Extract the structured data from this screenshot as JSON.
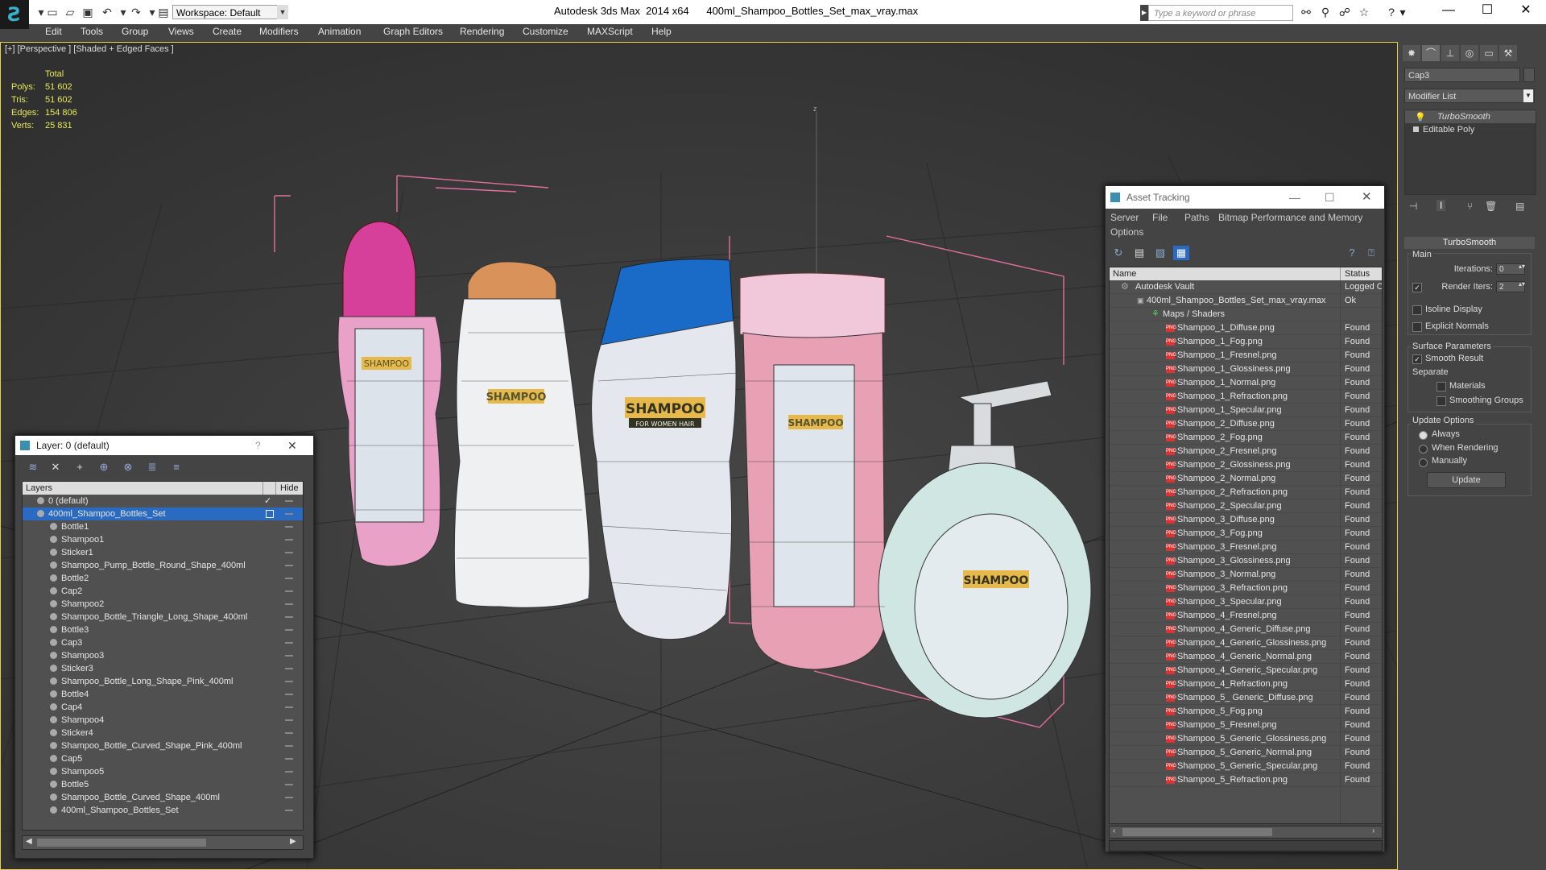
{
  "titlebar": {
    "workspace": "Workspace: Default",
    "app": "Autodesk 3ds Max  2014 x64",
    "file": "400ml_Shampoo_Bottles_Set_max_vray.max",
    "search_placeholder": "Type a keyword or phrase"
  },
  "menu": [
    "Edit",
    "Tools",
    "Group",
    "Views",
    "Create",
    "Modifiers",
    "Animation",
    "Graph Editors",
    "Rendering",
    "Customize",
    "MAXScript",
    "Help"
  ],
  "viewport": {
    "label": "[+] [Perspective ] [Shaded + Edged Faces ]",
    "axis_label": "z",
    "stats": {
      "header": "Total",
      "rows": [
        {
          "k": "Polys:",
          "v": "51 602"
        },
        {
          "k": "Tris:",
          "v": "51 602"
        },
        {
          "k": "Edges:",
          "v": "154 806"
        },
        {
          "k": "Verts:",
          "v": "25 831"
        }
      ]
    },
    "label_text": {
      "large": "SHAMPOO",
      "sub": "FOR WOMEN HAIR"
    }
  },
  "cmd": {
    "object_name": "Cap3",
    "modifier_list": "Modifier List",
    "stack": [
      "TurboSmooth",
      "Editable Poly"
    ],
    "turbosmooth": "TurboSmooth",
    "main": "Main",
    "iterations_label": "Iterations:",
    "iterations": "0",
    "render_iters_label": "Render Iters:",
    "render_iters": "2",
    "isoline": "Isoline Display",
    "explicit": "Explicit Normals",
    "surface": "Surface Parameters",
    "smooth_result": "Smooth Result",
    "separate": "Separate",
    "materials": "Materials",
    "smoothing_groups": "Smoothing Groups",
    "update_options": "Update Options",
    "always": "Always",
    "when_rendering": "When Rendering",
    "manually": "Manually",
    "update_btn": "Update"
  },
  "layer": {
    "title": "Layer: 0 (default)",
    "help": "?",
    "col_layers": "Layers",
    "col_hide": "Hide",
    "rows": [
      {
        "name": "0 (default)",
        "indent": 0,
        "kind": "layer",
        "checked": true
      },
      {
        "name": "400ml_Shampoo_Bottles_Set",
        "indent": 0,
        "kind": "layer",
        "selected": true
      },
      {
        "name": "Bottle1",
        "indent": 1
      },
      {
        "name": "Shampoo1",
        "indent": 1
      },
      {
        "name": "Sticker1",
        "indent": 1
      },
      {
        "name": "Shampoo_Pump_Bottle_Round_Shape_400ml",
        "indent": 1
      },
      {
        "name": "Bottle2",
        "indent": 1
      },
      {
        "name": "Cap2",
        "indent": 1
      },
      {
        "name": "Shampoo2",
        "indent": 1
      },
      {
        "name": "Shampoo_Bottle_Triangle_Long_Shape_400ml",
        "indent": 1
      },
      {
        "name": "Bottle3",
        "indent": 1
      },
      {
        "name": "Cap3",
        "indent": 1
      },
      {
        "name": "Shampoo3",
        "indent": 1
      },
      {
        "name": "Sticker3",
        "indent": 1
      },
      {
        "name": "Shampoo_Bottle_Long_Shape_Pink_400ml",
        "indent": 1
      },
      {
        "name": "Bottle4",
        "indent": 1
      },
      {
        "name": "Cap4",
        "indent": 1
      },
      {
        "name": "Shampoo4",
        "indent": 1
      },
      {
        "name": "Sticker4",
        "indent": 1
      },
      {
        "name": "Shampoo_Bottle_Curved_Shape_Pink_400ml",
        "indent": 1
      },
      {
        "name": "Cap5",
        "indent": 1
      },
      {
        "name": "Shampoo5",
        "indent": 1
      },
      {
        "name": "Bottle5",
        "indent": 1
      },
      {
        "name": "Shampoo_Bottle_Curved_Shape_400ml",
        "indent": 1
      },
      {
        "name": "400ml_Shampoo_Bottles_Set",
        "indent": 1
      }
    ]
  },
  "asset": {
    "title": "Asset Tracking",
    "menu1": [
      "Server",
      "File",
      "Paths",
      "Bitmap Performance and Memory"
    ],
    "menu2": [
      "Options"
    ],
    "col_name": "Name",
    "col_status": "Status",
    "vault": {
      "name": "Autodesk Vault",
      "status": "Logged Out"
    },
    "file": {
      "name": "400ml_Shampoo_Bottles_Set_max_vray.max",
      "status": "Ok"
    },
    "maps": {
      "name": "Maps / Shaders",
      "status": ""
    },
    "items": [
      "Shampoo_1_Diffuse.png",
      "Shampoo_1_Fog.png",
      "Shampoo_1_Fresnel.png",
      "Shampoo_1_Glossiness.png",
      "Shampoo_1_Normal.png",
      "Shampoo_1_Refraction.png",
      "Shampoo_1_Specular.png",
      "Shampoo_2_Diffuse.png",
      "Shampoo_2_Fog.png",
      "Shampoo_2_Fresnel.png",
      "Shampoo_2_Glossiness.png",
      "Shampoo_2_Normal.png",
      "Shampoo_2_Refraction.png",
      "Shampoo_2_Specular.png",
      "Shampoo_3_Diffuse.png",
      "Shampoo_3_Fog.png",
      "Shampoo_3_Fresnel.png",
      "Shampoo_3_Glossiness.png",
      "Shampoo_3_Normal.png",
      "Shampoo_3_Refraction.png",
      "Shampoo_3_Specular.png",
      "Shampoo_4_Fresnel.png",
      "Shampoo_4_Generic_Diffuse.png",
      "Shampoo_4_Generic_Glossiness.png",
      "Shampoo_4_Generic_Normal.png",
      "Shampoo_4_Generic_Specular.png",
      "Shampoo_4_Refraction.png",
      "Shampoo_5_ Generic_Diffuse.png",
      "Shampoo_5_Fog.png",
      "Shampoo_5_Fresnel.png",
      "Shampoo_5_Generic_Glossiness.png",
      "Shampoo_5_Generic_Normal.png",
      "Shampoo_5_Generic_Specular.png",
      "Shampoo_5_Refraction.png"
    ],
    "found": "Found",
    "png_tag": "PNG"
  },
  "colors": {
    "viewport_bg": "#3a3a3a",
    "selection": "#2a6ac0",
    "bbox_pink": "#e0709a",
    "stat_yellow": "#e8e85a"
  }
}
